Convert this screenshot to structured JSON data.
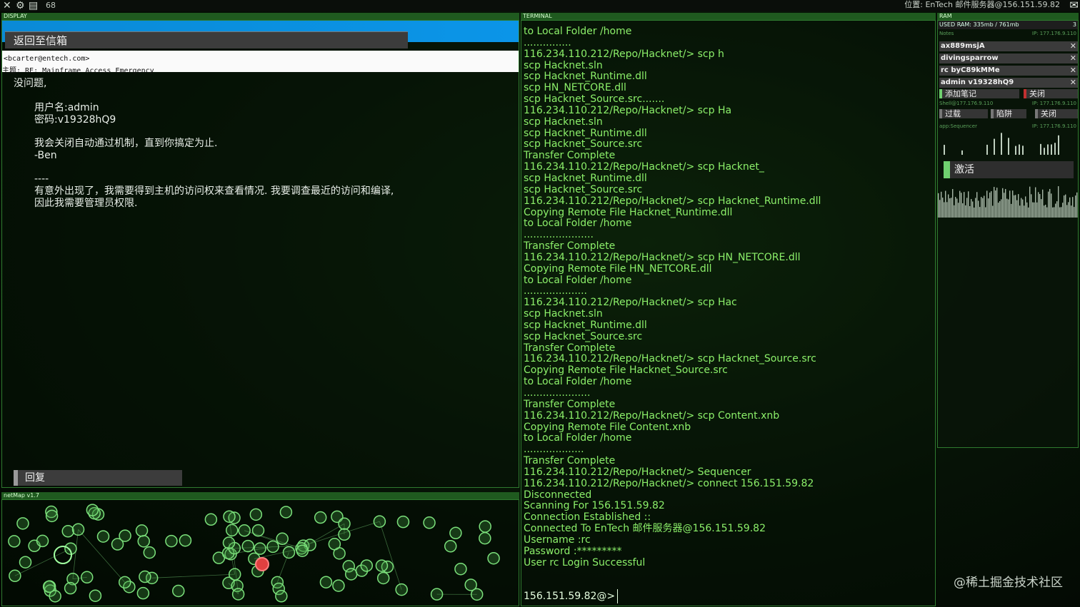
{
  "topbar": {
    "count": "68",
    "location": "位置: EnTech 邮件服务器@156.151.59.82"
  },
  "display": {
    "label": "DISPLAY",
    "back_button": "返回至信箱",
    "email": {
      "from": "<bcarter@entech.com>",
      "subject": "主题: RE: Mainframe Access Emergency",
      "greeting": "没问题,",
      "username_line": "用户名:admin",
      "password_line": "密码:v19328hQ9",
      "line1": "我会关闭自动通过机制，直到你搞定为止.",
      "signature": "-Ben",
      "separator": "----",
      "quote1": "有意外出现了，我需要得到主机的访问权来查看情况. 我要调查最近的访问和编译,",
      "quote2": "因此我需要管理员权限."
    },
    "reply_button": "回复"
  },
  "netmap": {
    "label": "netMap v1.7"
  },
  "terminal": {
    "label": "TERMINAL",
    "lines": [
      "to Local Folder /home",
      "...............",
      "116.234.110.212/Repo/Hacknet/> scp h",
      "scp Hacknet.sln",
      "scp Hacknet_Runtime.dll",
      "scp HN_NETCORE.dll",
      "scp Hacknet_Source.src.......",
      "116.234.110.212/Repo/Hacknet/> scp Ha",
      "scp Hacknet.sln",
      "scp Hacknet_Runtime.dll",
      "scp Hacknet_Source.src",
      "Transfer Complete",
      "116.234.110.212/Repo/Hacknet/> scp Hacknet_",
      "scp Hacknet_Runtime.dll",
      "scp Hacknet_Source.src",
      "116.234.110.212/Repo/Hacknet/> scp Hacknet_Runtime.dll",
      "Copying Remote File Hacknet_Runtime.dll",
      "to Local Folder /home",
      "......................",
      "Transfer Complete",
      "116.234.110.212/Repo/Hacknet/> scp HN_NETCORE.dll",
      "Copying Remote File HN_NETCORE.dll",
      "to Local Folder /home",
      "....................",
      "116.234.110.212/Repo/Hacknet/> scp Hac",
      "scp Hacknet.sln",
      "scp Hacknet_Runtime.dll",
      "scp Hacknet_Source.src",
      "Transfer Complete",
      "116.234.110.212/Repo/Hacknet/> scp Hacknet_Source.src",
      "Copying Remote File Hacknet_Source.src",
      "to Local Folder /home",
      ".....................",
      "Transfer Complete",
      "116.234.110.212/Repo/Hacknet/> scp Content.xnb",
      "Copying Remote File Content.xnb",
      "to Local Folder /home",
      "...................",
      "Transfer Complete",
      "116.234.110.212/Repo/Hacknet/> Sequencer",
      "116.234.110.212/Repo/Hacknet/> connect 156.151.59.82",
      "Disconnected",
      "Scanning For 156.151.59.82",
      "Connection Established ::",
      "Connected To EnTech 邮件服务器@156.151.59.82",
      "Username :rc",
      "Password :*********",
      "User rc Login Successful"
    ],
    "prompt": "156.151.59.82@>"
  },
  "ram": {
    "label": "RAM",
    "used": "USED RAM: 335mb / 761mb",
    "used_count": "3",
    "notes_label": "Notes",
    "notes_ip": "IP: 177.176.9.110",
    "notes": [
      "ax889msjA",
      "divingsparrow",
      "rc byC89kMMe",
      "admin v19328hQ9"
    ],
    "add_note": "添加笔记",
    "close": "关闭",
    "shell_label": "Shell@177.176.9.110",
    "shell_ip": "IP: 177.176.9.110",
    "shell_buttons": [
      "过载",
      "陷阱",
      "关闭"
    ],
    "seq_label": "app:Sequencer",
    "seq_ip": "IP: 177.176.9.110",
    "activate": "激活"
  },
  "watermark": "@稀土掘金技术社区",
  "colors": {
    "terminal_text": "#8cf06a",
    "border": "#2f7a2f",
    "accent_blue": "#0b95e8",
    "node": "#7be07b",
    "node_active": "#e04040"
  }
}
